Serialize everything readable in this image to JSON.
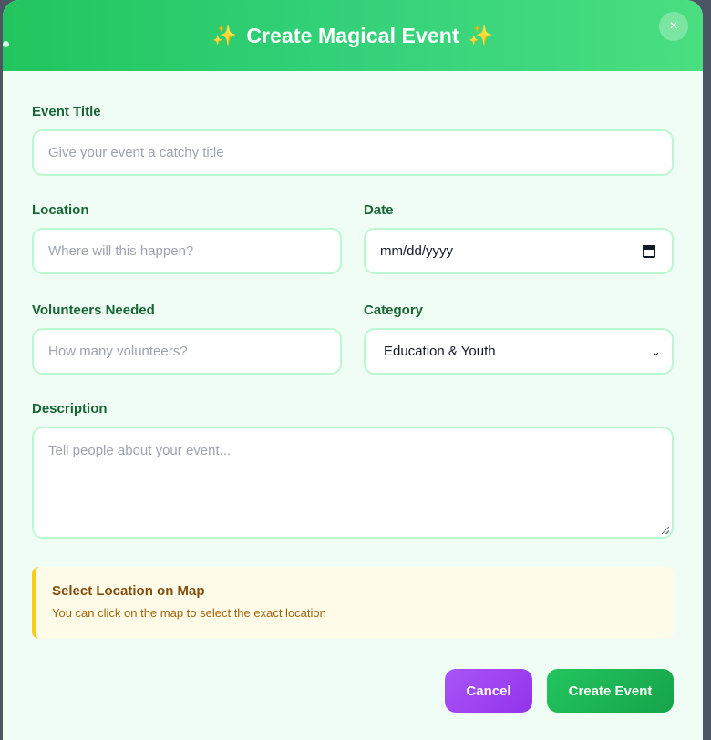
{
  "modal": {
    "title": "Create Magical Event",
    "sparkle_left": "✨",
    "sparkle_right": "✨",
    "close_label": "×"
  },
  "fields": {
    "title": {
      "label": "Event Title",
      "placeholder": "Give your event a catchy title",
      "value": ""
    },
    "location": {
      "label": "Location",
      "placeholder": "Where will this happen?",
      "value": ""
    },
    "date": {
      "label": "Date",
      "value": "mm/dd/yyyy"
    },
    "volunteers": {
      "label": "Volunteers Needed",
      "placeholder": "How many volunteers?",
      "value": ""
    },
    "category": {
      "label": "Category",
      "value": "Education & Youth"
    },
    "description": {
      "label": "Description",
      "placeholder": "Tell people about your event...",
      "value": ""
    }
  },
  "notice": {
    "title": "Select Location on Map",
    "text": "You can click on the map to select the exact location"
  },
  "actions": {
    "cancel_label": "Cancel",
    "create_label": "Create Event"
  },
  "colors": {
    "header_gradient_start": "#22c55e",
    "header_gradient_end": "#4ade80",
    "modal_background": "#f0fdf4",
    "label_color": "#166534",
    "input_border": "#bbf7d0",
    "notice_background": "#fefce8",
    "notice_accent": "#facc15",
    "cancel_button": "#a855f7",
    "create_button": "#22c55e"
  }
}
